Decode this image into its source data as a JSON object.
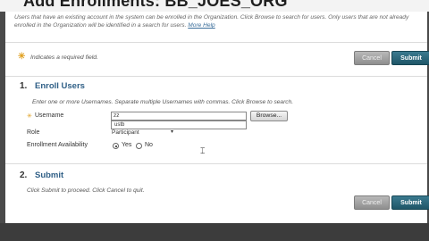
{
  "header": {
    "title": "Add Enrollments: BB_JOES_ORG"
  },
  "intro": {
    "text": "Users that have an existing account in the system can be enrolled in the Organization. Click Browse to search for users. Only users that are not already enrolled in the Organization will be identified in a search for users.",
    "more_help": "More Help"
  },
  "required_note": "Indicates a required field.",
  "buttons": {
    "cancel": "Cancel",
    "submit": "Submit"
  },
  "section1": {
    "number": "1.",
    "title": "Enroll Users",
    "instructions": "Enter one or more Usernames. Separate multiple Usernames with commas. Click Browse to search.",
    "username_label": "Username",
    "username_value": "zz",
    "autocomplete_value": "ustb",
    "browse_label": "Browse...",
    "role_label": "Role",
    "role_value": "Participant",
    "availability_label": "Enrollment Availability",
    "yes_label": "Yes",
    "no_label": "No",
    "availability_selected": "Yes"
  },
  "section2": {
    "number": "2.",
    "title": "Submit",
    "instructions": "Click Submit to proceed. Click Cancel to quit."
  },
  "colors": {
    "accent": "#2f5f86",
    "submit_button": "#1f5668",
    "required_star": "#e0a020"
  }
}
